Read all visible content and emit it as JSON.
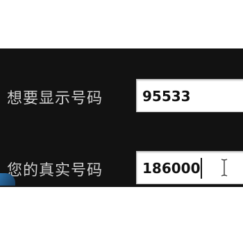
{
  "form": {
    "display_number": {
      "label": "想要显示号码",
      "value": "95533"
    },
    "real_number": {
      "label": "您的真实号码",
      "value": "186000"
    }
  },
  "icons": {
    "cursor": "ibeam-cursor-icon"
  },
  "colors": {
    "panel_background": "#121212",
    "label_text": "#cfcfcf",
    "field_background": "#ffffff",
    "field_text": "#111111"
  }
}
